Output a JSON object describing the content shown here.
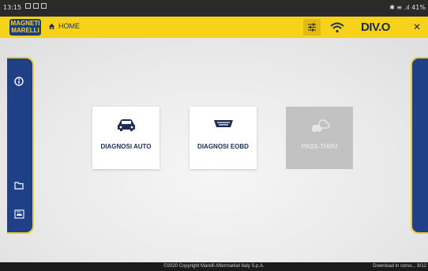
{
  "status_bar": {
    "time": "13:15",
    "right": "✱ ≡ .ıl 41%"
  },
  "header": {
    "logo_line1": "MAGNETI",
    "logo_line2": "MARELLI",
    "home_label": "HOME",
    "brand": "DIV.O",
    "close_symbol": "✕"
  },
  "tiles": [
    {
      "label": "DIAGNOSI AUTO",
      "icon": "car-icon"
    },
    {
      "label": "DIAGNOSI EOBD",
      "icon": "obd-connector-icon"
    },
    {
      "label": "PASS-THRU",
      "icon": "cloud-car-icon",
      "disabled": true
    }
  ],
  "footer": {
    "copyright": "©2020 Copyright Marelli Aftermarket Italy S.p.A.",
    "download_status": "Download in corso... 8/12"
  },
  "colors": {
    "accent": "#f7d21a",
    "panel": "#1f3f86",
    "text_dark": "#1d2d55"
  }
}
